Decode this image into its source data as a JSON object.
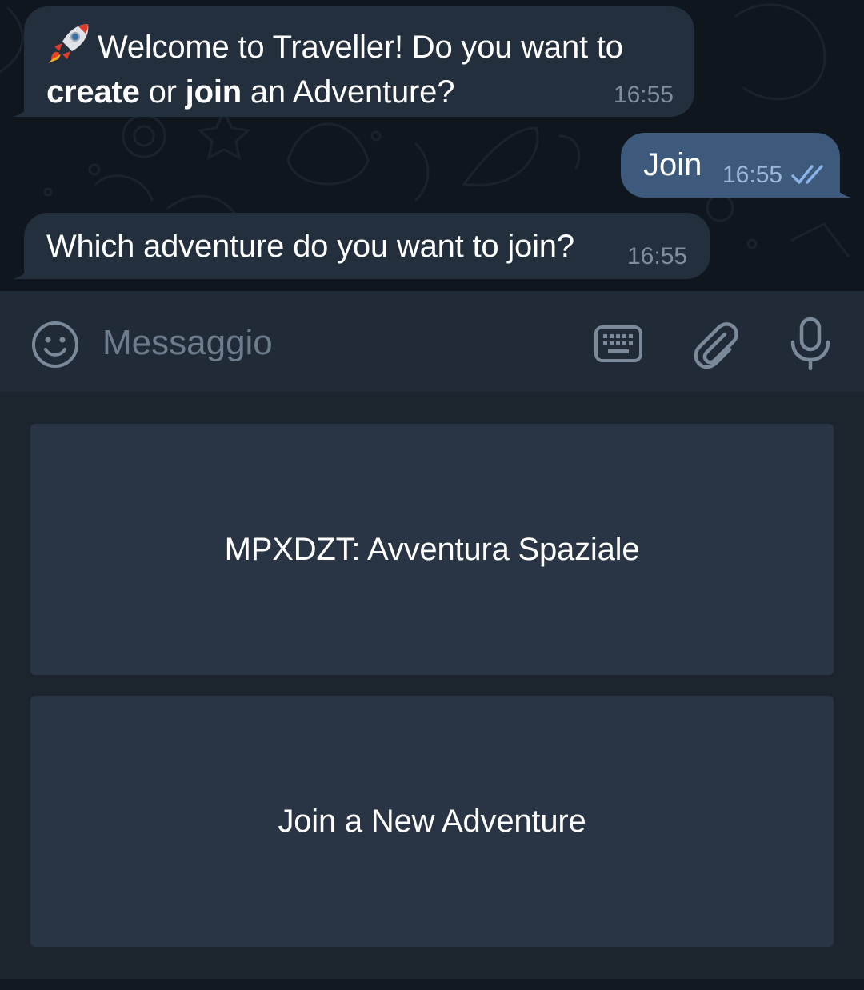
{
  "colors": {
    "chat_background": "#0f161e",
    "incoming_bubble": "#232f3c",
    "outgoing_bubble": "#3d5a7d",
    "composer_background": "#202b37",
    "keyboard_background": "#1c242e",
    "keyboard_button": "#293544",
    "read_ticks": "#8ab4e8"
  },
  "messages": [
    {
      "direction": "incoming",
      "emoji": "rocket",
      "parts": {
        "intro": "Welcome to Traveller! Do you want to",
        "create": "create",
        "or": " or ",
        "join": "join",
        "tail": " an Adventure?"
      },
      "time": "16:55"
    },
    {
      "direction": "outgoing",
      "text": "Join",
      "time": "16:55",
      "status_icon": "double-check-icon"
    },
    {
      "direction": "incoming",
      "text": "Which adventure do you want to join?",
      "time": "16:55"
    }
  ],
  "composer": {
    "placeholder": "Messaggio",
    "icons": [
      "smiley-icon",
      "keyboard-icon",
      "paperclip-icon",
      "microphone-icon"
    ]
  },
  "reply_keyboard": {
    "buttons": [
      {
        "label": "MPXDZT: Avventura Spaziale"
      },
      {
        "label": "Join a New Adventure"
      }
    ]
  }
}
